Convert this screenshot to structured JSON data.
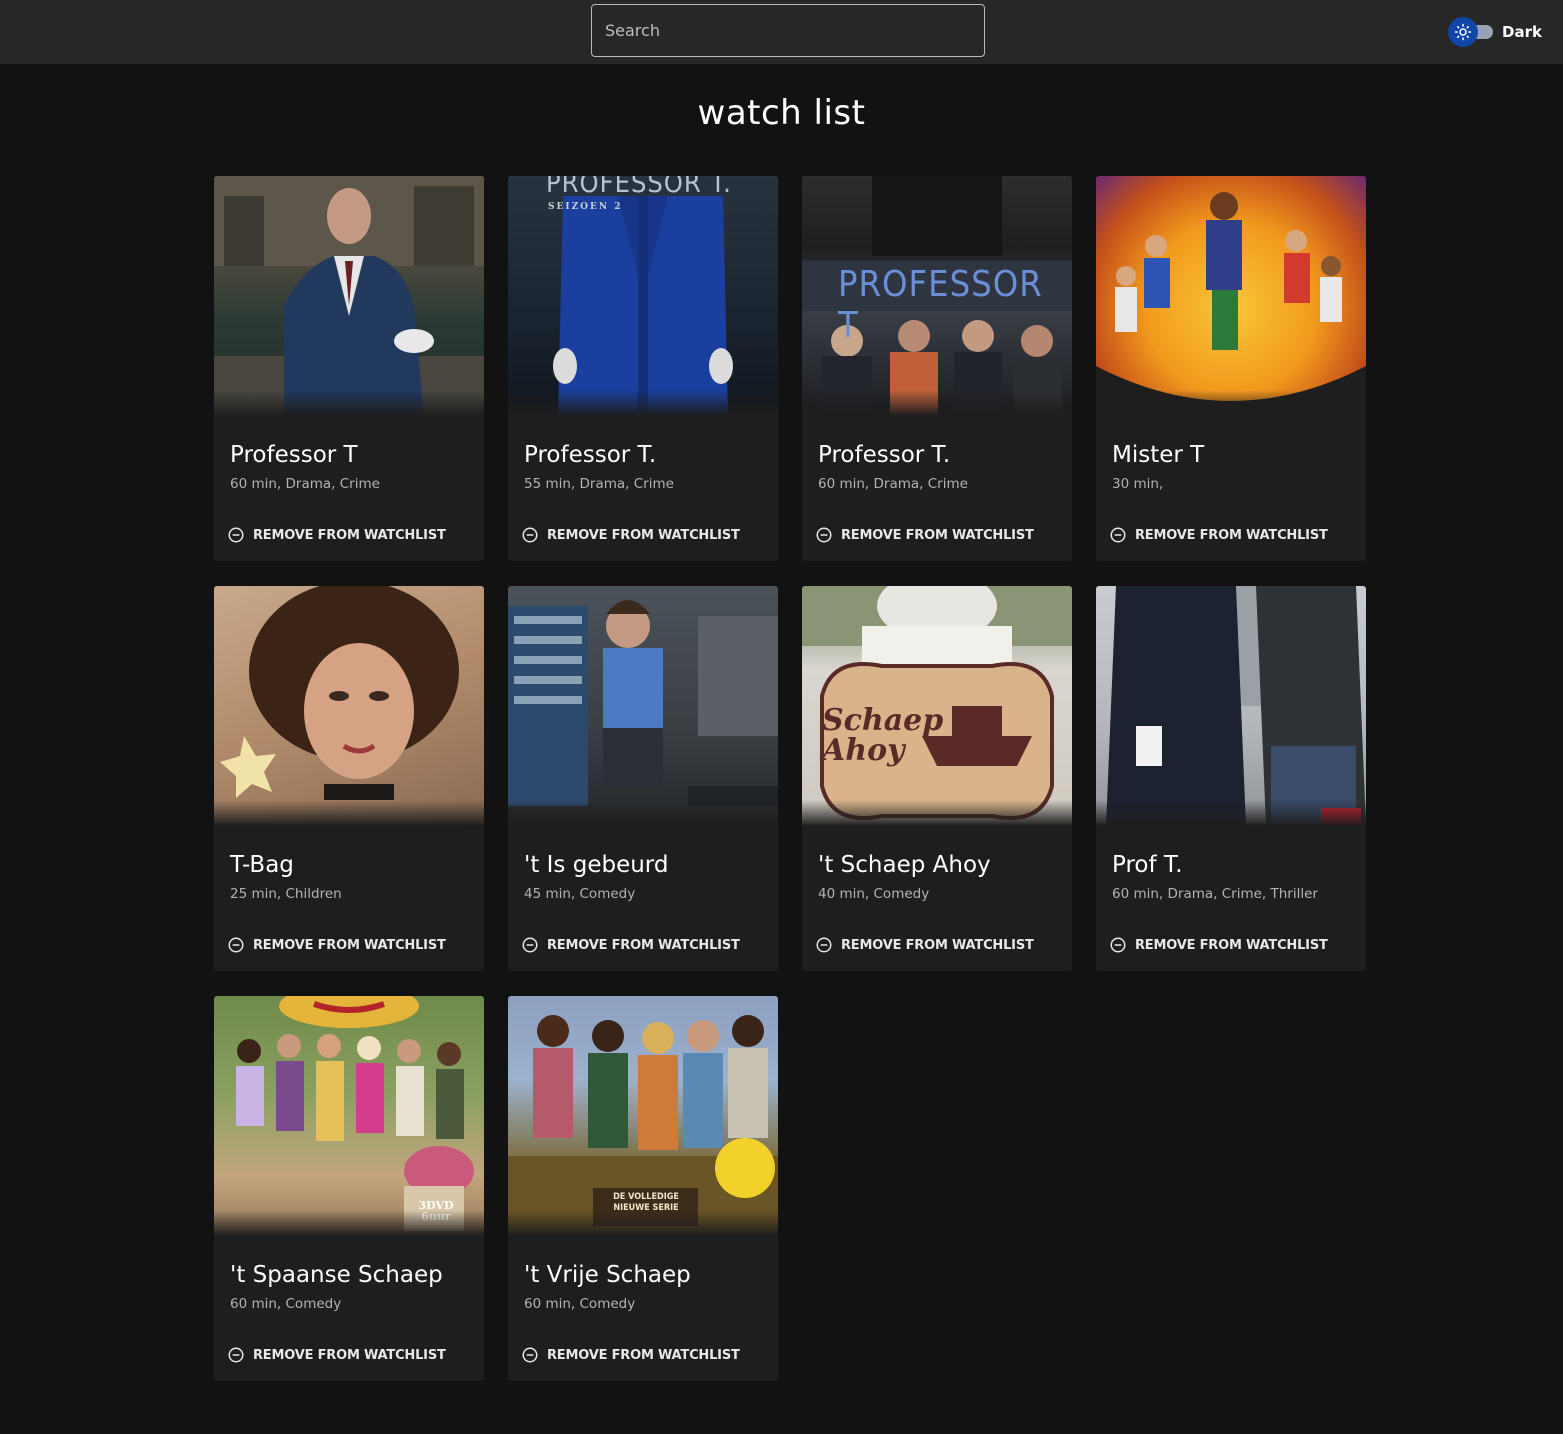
{
  "search": {
    "placeholder": "Search"
  },
  "theme": {
    "label": "Dark"
  },
  "page": {
    "title": "watch list"
  },
  "colors": {
    "accent": "#1146a6",
    "background": "#121212",
    "card": "#1e1e1e",
    "topbar": "#272727"
  },
  "action_icon": "remove-circle-icon",
  "items": [
    {
      "title": "Professor T",
      "meta": "60 min, Drama, Crime",
      "action": "REMOVE FROM WATCHLIST"
    },
    {
      "title": "Professor T.",
      "meta": "55 min, Drama, Crime",
      "action": "REMOVE FROM WATCHLIST",
      "poster_text": "PROFESSOR T.",
      "poster_sub": "SEIZOEN 2"
    },
    {
      "title": "Professor T.",
      "meta": "60 min, Drama, Crime",
      "action": "REMOVE FROM WATCHLIST",
      "poster_text": "PROFESSOR T"
    },
    {
      "title": "Mister T",
      "meta": "30 min,",
      "action": "REMOVE FROM WATCHLIST"
    },
    {
      "title": "T-Bag",
      "meta": "25 min, Children",
      "action": "REMOVE FROM WATCHLIST"
    },
    {
      "title": "'t Is gebeurd",
      "meta": "45 min, Comedy",
      "action": "REMOVE FROM WATCHLIST"
    },
    {
      "title": "'t Schaep Ahoy",
      "meta": "40 min, Comedy",
      "action": "REMOVE FROM WATCHLIST",
      "poster_text": "Schaep Ahoy"
    },
    {
      "title": "Prof T.",
      "meta": "60 min, Drama, Crime, Thriller",
      "action": "REMOVE FROM WATCHLIST"
    },
    {
      "title": "'t Spaanse Schaep",
      "meta": "60 min, Comedy",
      "action": "REMOVE FROM WATCHLIST",
      "poster_text": "3DVD 6uur"
    },
    {
      "title": "'t Vrije Schaep",
      "meta": "60 min, Comedy",
      "action": "REMOVE FROM WATCHLIST",
      "poster_text": "DE VOLLEDIGE NIEUWE SERIE"
    }
  ]
}
